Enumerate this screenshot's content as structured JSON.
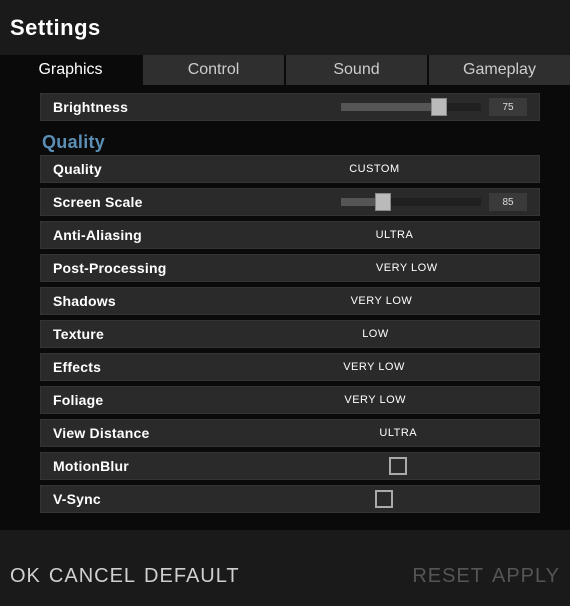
{
  "header": {
    "title": "Settings"
  },
  "tabs": {
    "graphics": "Graphics",
    "control": "Control",
    "sound": "Sound",
    "gameplay": "Gameplay"
  },
  "sections": {
    "quality_header": "Quality"
  },
  "settings": {
    "brightness": {
      "label": "Brightness",
      "value": "75"
    },
    "quality": {
      "label": "Quality",
      "value": "CUSTOM"
    },
    "screen_scale": {
      "label": "Screen Scale",
      "value": "85"
    },
    "anti_aliasing": {
      "label": "Anti-Aliasing",
      "value": "ULTRA"
    },
    "post_processing": {
      "label": "Post-Processing",
      "value": "VERY LOW"
    },
    "shadows": {
      "label": "Shadows",
      "value": "VERY LOW"
    },
    "texture": {
      "label": "Texture",
      "value": "LOW"
    },
    "effects": {
      "label": "Effects",
      "value": "VERY LOW"
    },
    "foliage": {
      "label": "Foliage",
      "value": "VERY LOW"
    },
    "view_distance": {
      "label": "View Distance",
      "value": "ULTRA"
    },
    "motion_blur": {
      "label": "MotionBlur"
    },
    "vsync": {
      "label": "V-Sync"
    }
  },
  "footer": {
    "ok": "OK",
    "cancel": "CANCEL",
    "default": "DEFAULT",
    "reset": "RESET",
    "apply": "APPLY"
  }
}
